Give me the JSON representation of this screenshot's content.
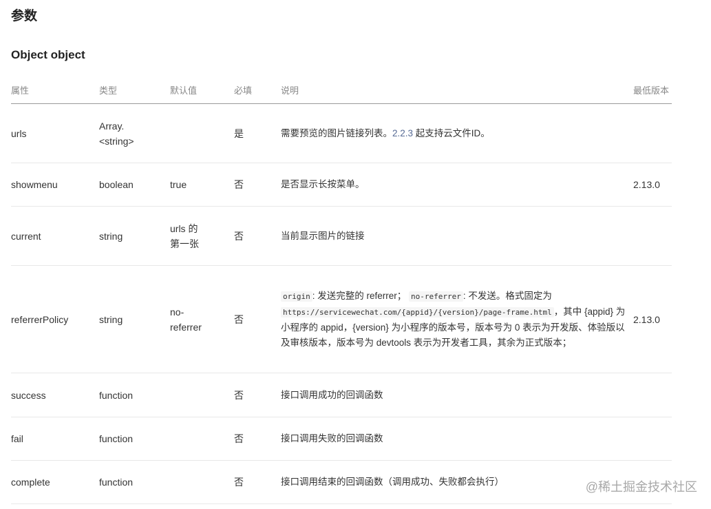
{
  "section_title": "参数",
  "object_title": "Object object",
  "table": {
    "headers": {
      "attr": "属性",
      "type": "类型",
      "default": "默认值",
      "required": "必填",
      "desc": "说明",
      "version": "最低版本"
    },
    "rows": [
      {
        "attr": "urls",
        "type": "Array.\n<string>",
        "default": "",
        "required": "是",
        "desc_before": "需要预览的图片链接列表。",
        "desc_link": "2.2.3",
        "desc_after": " 起支持云文件ID。",
        "version": ""
      },
      {
        "attr": "showmenu",
        "type": "boolean",
        "default": "true",
        "required": "否",
        "desc": "是否显示长按菜单。",
        "version": "2.13.0"
      },
      {
        "attr": "current",
        "type": "string",
        "default": "urls 的\n第一张",
        "required": "否",
        "desc": "当前显示图片的链接",
        "version": ""
      },
      {
        "attr": "referrerPolicy",
        "type": "string",
        "default": "no-\nreferrer",
        "required": "否",
        "desc_code1": "origin",
        "desc_text1": ": 发送完整的 referrer；",
        "desc_code2": "no-referrer",
        "desc_text2": ": 不发送。格式固定为",
        "desc_code3": "https://servicewechat.com/{appid}/{version}/page-frame.html",
        "desc_text3": "，其中 {appid} 为小程序的 appid，{version} 为小程序的版本号，版本号为 0 表示为开发版、体验版以及审核版本，版本号为 devtools 表示为开发者工具，其余为正式版本；",
        "version": "2.13.0"
      },
      {
        "attr": "success",
        "type": "function",
        "default": "",
        "required": "否",
        "desc": "接口调用成功的回调函数",
        "version": ""
      },
      {
        "attr": "fail",
        "type": "function",
        "default": "",
        "required": "否",
        "desc": "接口调用失败的回调函数",
        "version": ""
      },
      {
        "attr": "complete",
        "type": "function",
        "default": "",
        "required": "否",
        "desc": "接口调用结束的回调函数（调用成功、失败都会执行）",
        "version": ""
      }
    ]
  },
  "watermark": "@稀土掘金技术社区"
}
